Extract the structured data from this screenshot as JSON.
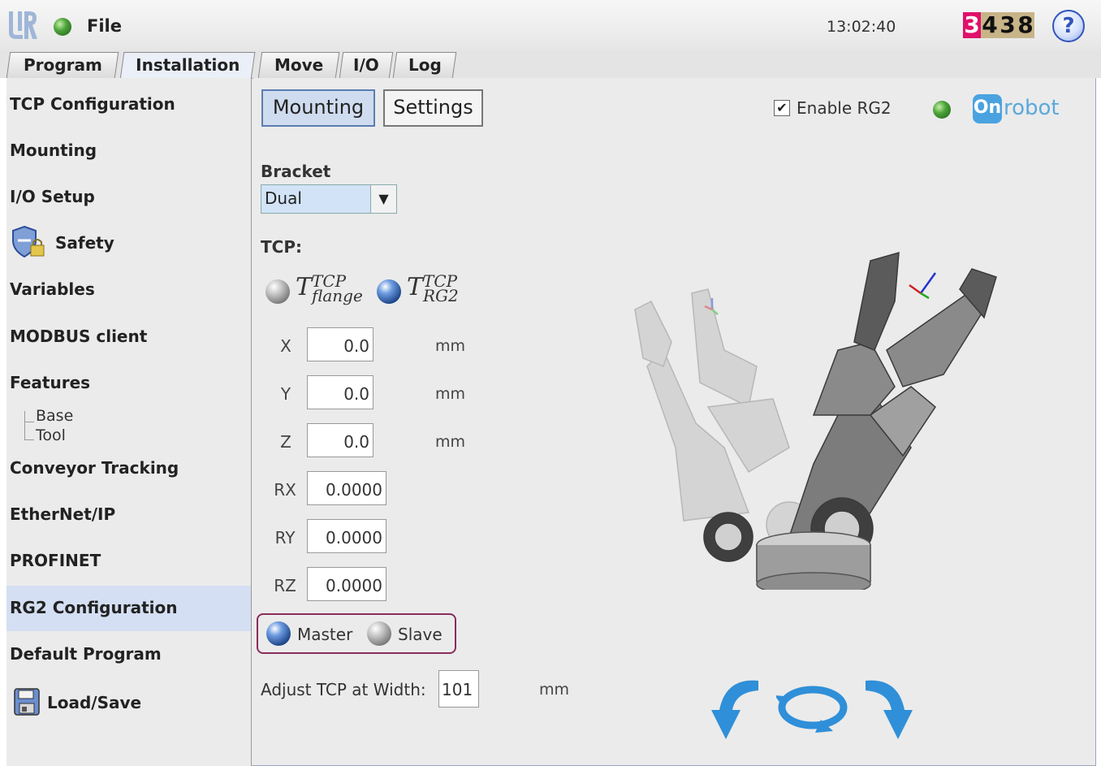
{
  "header": {
    "menu_label": "File",
    "clock": "13:02:40",
    "counter_digits": [
      "3",
      "4",
      "3",
      "8"
    ],
    "counter_colors": [
      "#e0106b",
      "#c8b488",
      "#c8b488",
      "#c8b488"
    ],
    "help_glyph": "?"
  },
  "tabs": [
    {
      "label": "Program"
    },
    {
      "label": "Installation",
      "active": true
    },
    {
      "label": "Move"
    },
    {
      "label": "I/O"
    },
    {
      "label": "Log"
    }
  ],
  "sidebar": {
    "items": [
      {
        "label": "TCP Configuration"
      },
      {
        "label": "Mounting"
      },
      {
        "label": "I/O Setup"
      },
      {
        "label": "Safety",
        "icon": "shield-lock-icon"
      },
      {
        "label": "Variables"
      },
      {
        "label": "MODBUS client"
      },
      {
        "label": "Features"
      },
      {
        "label": "Conveyor Tracking"
      },
      {
        "label": "EtherNet/IP"
      },
      {
        "label": "PROFINET"
      },
      {
        "label": "RG2 Configuration",
        "selected": true
      },
      {
        "label": "Default Program"
      },
      {
        "label": "Load/Save",
        "icon": "floppy-disk-icon"
      }
    ],
    "feature_children": [
      "Base",
      "Tool"
    ]
  },
  "content": {
    "subtabs": [
      {
        "label": "Mounting",
        "active": true
      },
      {
        "label": "Settings"
      }
    ],
    "enable": {
      "label": "Enable RG2",
      "checked": true,
      "check_glyph": "✔"
    },
    "brand": {
      "mark": "On",
      "text": "robot"
    },
    "bracket": {
      "label": "Bracket",
      "value": "Dual",
      "arrow": "▼"
    },
    "tcp": {
      "label": "TCP:",
      "options": [
        {
          "base": "T",
          "sup": "TCP",
          "sub": "flange",
          "selected": false
        },
        {
          "base": "T",
          "sup": "TCP",
          "sub": "RG2",
          "selected": true
        }
      ]
    },
    "fields": [
      {
        "label": "X",
        "value": "0.0",
        "unit": "mm"
      },
      {
        "label": "Y",
        "value": "0.0",
        "unit": "mm"
      },
      {
        "label": "Z",
        "value": "0.0",
        "unit": "mm"
      },
      {
        "label": "RX",
        "value": "0.0000"
      },
      {
        "label": "RY",
        "value": "0.0000"
      },
      {
        "label": "RZ",
        "value": "0.0000"
      }
    ],
    "role": {
      "options": [
        {
          "label": "Master",
          "selected": true
        },
        {
          "label": "Slave",
          "selected": false
        }
      ]
    },
    "adjust": {
      "label": "Adjust TCP at Width:",
      "value": "101",
      "unit": "mm"
    }
  },
  "colors": {
    "accent_blue": "#2f8fd8",
    "selection": "#d4dff3",
    "role_border": "#8b2c5a",
    "status_green": "#4ca33a"
  }
}
